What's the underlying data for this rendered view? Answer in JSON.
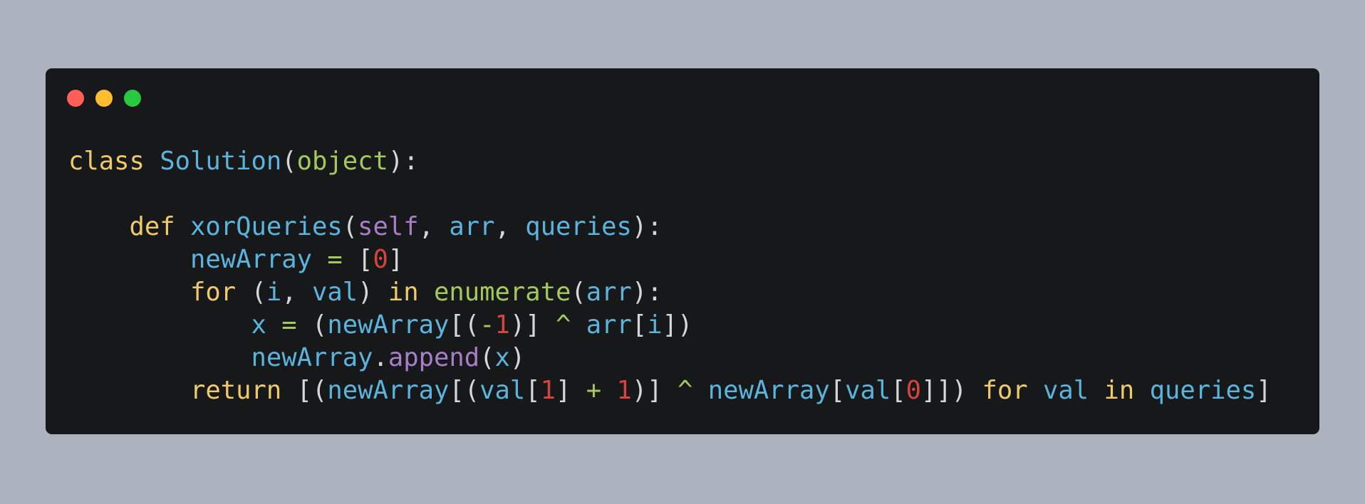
{
  "window": {
    "controls": [
      {
        "name": "close-button",
        "color": "#ff5f57"
      },
      {
        "name": "minimize-button",
        "color": "#febc2e"
      },
      {
        "name": "maximize-button",
        "color": "#28c840"
      }
    ]
  },
  "theme": {
    "background": "#abb4be",
    "editor_bg": "#16181a",
    "keyword": "#f0ca6a",
    "identifier": "#5ab4de",
    "builtin": "#a4c95a",
    "self": "#a97dc8",
    "method": "#a97dc8",
    "number": "#d6453d",
    "operator": "#a4c95a",
    "punctuation": "#d6d6d6"
  },
  "code": {
    "lines": [
      {
        "indent": 0,
        "tokens": [
          {
            "t": "class",
            "k": "keyword"
          },
          {
            "t": " ",
            "k": "space"
          },
          {
            "t": "Solution",
            "k": "identifier"
          },
          {
            "t": "(",
            "k": "punctuation"
          },
          {
            "t": "object",
            "k": "builtin"
          },
          {
            "t": "):",
            "k": "punctuation"
          }
        ]
      },
      {
        "indent": 0,
        "tokens": []
      },
      {
        "indent": 4,
        "tokens": [
          {
            "t": "def",
            "k": "keyword"
          },
          {
            "t": " ",
            "k": "space"
          },
          {
            "t": "xorQueries",
            "k": "identifier"
          },
          {
            "t": "(",
            "k": "punctuation"
          },
          {
            "t": "self",
            "k": "self"
          },
          {
            "t": ", ",
            "k": "punctuation"
          },
          {
            "t": "arr",
            "k": "identifier"
          },
          {
            "t": ", ",
            "k": "punctuation"
          },
          {
            "t": "queries",
            "k": "identifier"
          },
          {
            "t": "):",
            "k": "punctuation"
          }
        ]
      },
      {
        "indent": 8,
        "tokens": [
          {
            "t": "newArray",
            "k": "identifier"
          },
          {
            "t": " ",
            "k": "space"
          },
          {
            "t": "=",
            "k": "operator"
          },
          {
            "t": " ",
            "k": "space"
          },
          {
            "t": "[",
            "k": "punctuation"
          },
          {
            "t": "0",
            "k": "number"
          },
          {
            "t": "]",
            "k": "punctuation"
          }
        ]
      },
      {
        "indent": 8,
        "tokens": [
          {
            "t": "for",
            "k": "keyword"
          },
          {
            "t": " ",
            "k": "space"
          },
          {
            "t": "(",
            "k": "punctuation"
          },
          {
            "t": "i",
            "k": "identifier"
          },
          {
            "t": ", ",
            "k": "punctuation"
          },
          {
            "t": "val",
            "k": "identifier"
          },
          {
            "t": ") ",
            "k": "punctuation"
          },
          {
            "t": "in",
            "k": "keyword"
          },
          {
            "t": " ",
            "k": "space"
          },
          {
            "t": "enumerate",
            "k": "builtin"
          },
          {
            "t": "(",
            "k": "punctuation"
          },
          {
            "t": "arr",
            "k": "identifier"
          },
          {
            "t": "):",
            "k": "punctuation"
          }
        ]
      },
      {
        "indent": 12,
        "tokens": [
          {
            "t": "x",
            "k": "identifier"
          },
          {
            "t": " ",
            "k": "space"
          },
          {
            "t": "=",
            "k": "operator"
          },
          {
            "t": " ",
            "k": "space"
          },
          {
            "t": "(",
            "k": "punctuation"
          },
          {
            "t": "newArray",
            "k": "identifier"
          },
          {
            "t": "[(",
            "k": "punctuation"
          },
          {
            "t": "-",
            "k": "operator"
          },
          {
            "t": "1",
            "k": "number"
          },
          {
            "t": ")] ",
            "k": "punctuation"
          },
          {
            "t": "^",
            "k": "operator"
          },
          {
            "t": " ",
            "k": "space"
          },
          {
            "t": "arr",
            "k": "identifier"
          },
          {
            "t": "[",
            "k": "punctuation"
          },
          {
            "t": "i",
            "k": "identifier"
          },
          {
            "t": "])",
            "k": "punctuation"
          }
        ]
      },
      {
        "indent": 12,
        "tokens": [
          {
            "t": "newArray",
            "k": "identifier"
          },
          {
            "t": ".",
            "k": "punctuation"
          },
          {
            "t": "append",
            "k": "method"
          },
          {
            "t": "(",
            "k": "punctuation"
          },
          {
            "t": "x",
            "k": "identifier"
          },
          {
            "t": ")",
            "k": "punctuation"
          }
        ]
      },
      {
        "indent": 8,
        "tokens": [
          {
            "t": "return",
            "k": "keyword"
          },
          {
            "t": " ",
            "k": "space"
          },
          {
            "t": "[(",
            "k": "punctuation"
          },
          {
            "t": "newArray",
            "k": "identifier"
          },
          {
            "t": "[(",
            "k": "punctuation"
          },
          {
            "t": "val",
            "k": "identifier"
          },
          {
            "t": "[",
            "k": "punctuation"
          },
          {
            "t": "1",
            "k": "number"
          },
          {
            "t": "] ",
            "k": "punctuation"
          },
          {
            "t": "+",
            "k": "operator"
          },
          {
            "t": " ",
            "k": "space"
          },
          {
            "t": "1",
            "k": "number"
          },
          {
            "t": ")] ",
            "k": "punctuation"
          },
          {
            "t": "^",
            "k": "operator"
          },
          {
            "t": " ",
            "k": "space"
          },
          {
            "t": "newArray",
            "k": "identifier"
          },
          {
            "t": "[",
            "k": "punctuation"
          },
          {
            "t": "val",
            "k": "identifier"
          },
          {
            "t": "[",
            "k": "punctuation"
          },
          {
            "t": "0",
            "k": "number"
          },
          {
            "t": "]]) ",
            "k": "punctuation"
          },
          {
            "t": "for",
            "k": "keyword"
          },
          {
            "t": " ",
            "k": "space"
          },
          {
            "t": "val",
            "k": "identifier"
          },
          {
            "t": " ",
            "k": "space"
          },
          {
            "t": "in",
            "k": "keyword"
          },
          {
            "t": " ",
            "k": "space"
          },
          {
            "t": "queries",
            "k": "identifier"
          },
          {
            "t": "]",
            "k": "punctuation"
          }
        ]
      }
    ]
  }
}
